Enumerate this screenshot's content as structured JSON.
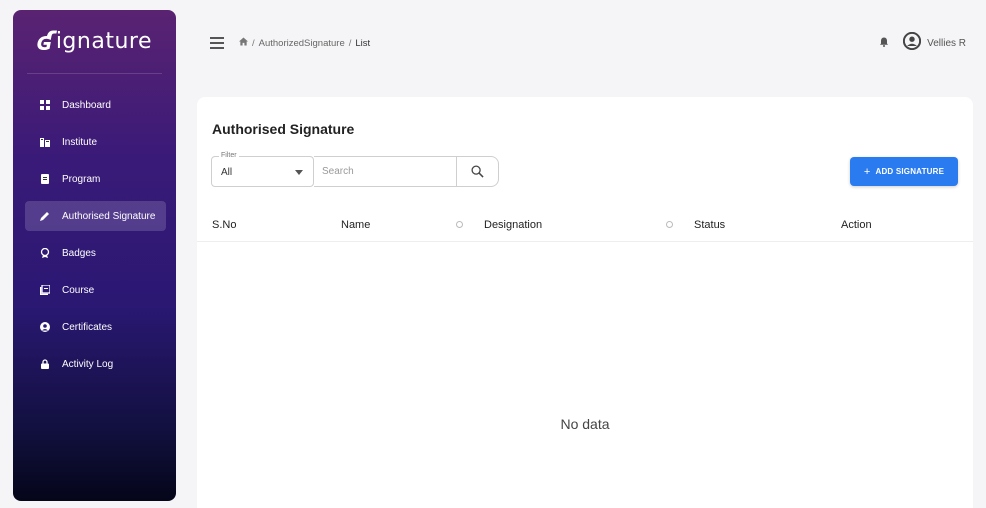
{
  "brand": {
    "mark": "ʛ",
    "name": "ignature"
  },
  "sidebar": {
    "items": [
      {
        "label": "Dashboard",
        "icon": "dashboard-icon"
      },
      {
        "label": "Institute",
        "icon": "institute-icon"
      },
      {
        "label": "Program",
        "icon": "program-icon"
      },
      {
        "label": "Authorised Signature",
        "icon": "pen-icon",
        "active": true
      },
      {
        "label": "Badges",
        "icon": "badge-icon"
      },
      {
        "label": "Course",
        "icon": "course-icon"
      },
      {
        "label": "Certificates",
        "icon": "certificate-icon"
      },
      {
        "label": "Activity Log",
        "icon": "lock-icon"
      }
    ]
  },
  "header": {
    "breadcrumb": {
      "sep1": "/",
      "parent": "AuthorizedSignature",
      "sep2": "/",
      "current": "List"
    },
    "user_name": "Vellies R"
  },
  "main": {
    "title": "Authorised Signature",
    "filter": {
      "legend": "Filter",
      "value": "All"
    },
    "search": {
      "placeholder": "Search"
    },
    "add_button": {
      "plus": "+",
      "label": "ADD SIGNATURE"
    },
    "table": {
      "columns": [
        "S.No",
        "Name",
        "Designation",
        "Status",
        "Action"
      ],
      "empty_text": "No data"
    }
  },
  "colors": {
    "accent": "#2a7bf0",
    "sidebar_top": "#5a2372",
    "sidebar_bottom": "#05061a"
  }
}
